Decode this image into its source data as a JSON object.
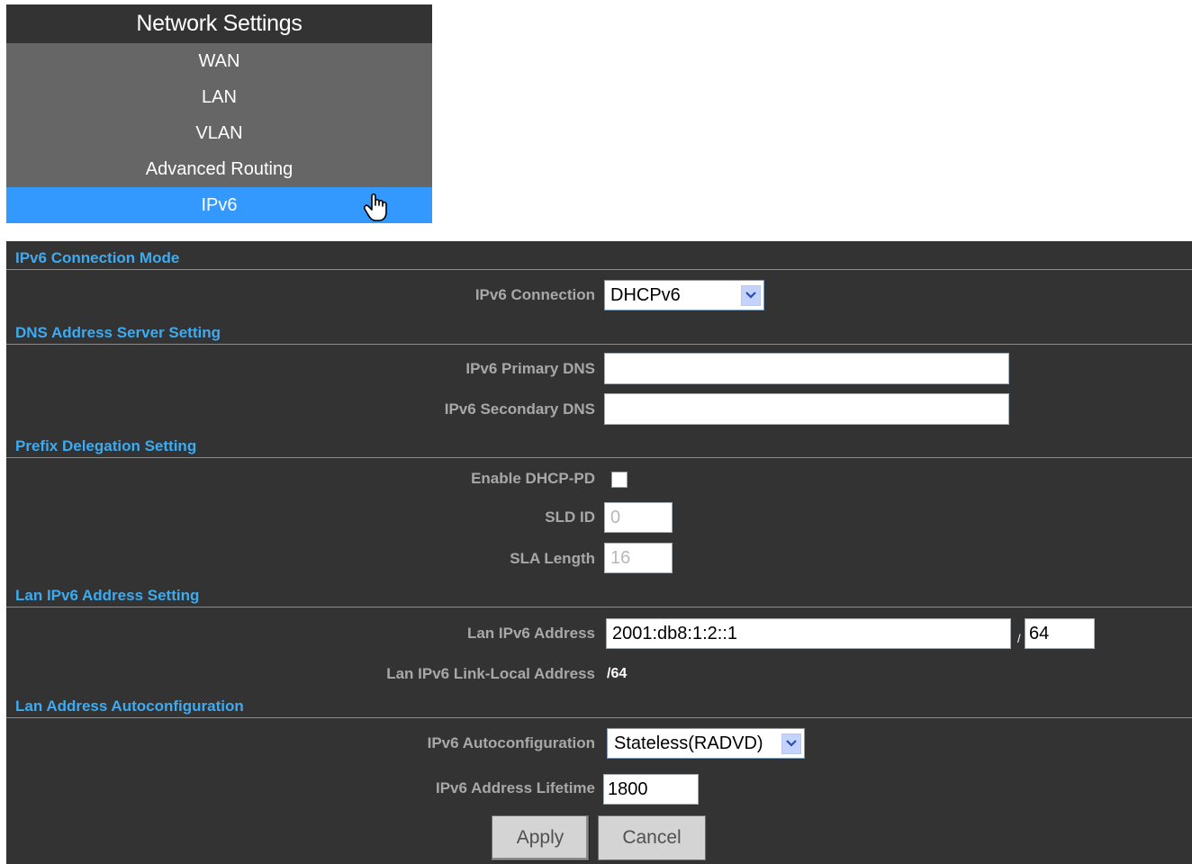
{
  "menu": {
    "title": "Network Settings",
    "items": [
      {
        "label": "WAN"
      },
      {
        "label": "LAN"
      },
      {
        "label": "VLAN"
      },
      {
        "label": "Advanced Routing"
      },
      {
        "label": "IPv6",
        "active": true
      }
    ]
  },
  "sections": {
    "connection_mode": "IPv6 Connection Mode",
    "dns": "DNS Address Server Setting",
    "prefix": "Prefix Delegation Setting",
    "lan_address": "Lan IPv6 Address Setting",
    "autoconfig": "Lan Address Autoconfiguration"
  },
  "fields": {
    "ipv6_connection": {
      "label": "IPv6 Connection",
      "value": "DHCPv6"
    },
    "primary_dns": {
      "label": "IPv6 Primary DNS",
      "value": ""
    },
    "secondary_dns": {
      "label": "IPv6 Secondary DNS",
      "value": ""
    },
    "enable_dhcp_pd": {
      "label": "Enable DHCP-PD",
      "checked": false
    },
    "sld_id": {
      "label": "SLD ID",
      "value": "0"
    },
    "sla_length": {
      "label": "SLA Length",
      "value": "16"
    },
    "lan_ipv6_address": {
      "label": "Lan IPv6 Address",
      "value": "2001:db8:1:2::1",
      "prefix_separator": "/",
      "prefix": "64"
    },
    "link_local": {
      "label": "Lan IPv6 Link-Local Address",
      "value": "/64"
    },
    "autoconfiguration": {
      "label": "IPv6 Autoconfiguration",
      "value": "Stateless(RADVD)"
    },
    "lifetime": {
      "label": "IPv6 Address Lifetime",
      "value": "1800"
    }
  },
  "buttons": {
    "apply": "Apply",
    "cancel": "Cancel"
  },
  "colors": {
    "panel_bg": "#333333",
    "section_title": "#3eaaf0",
    "active_menu": "#3399ff",
    "menu_item_bg": "#666666"
  },
  "icons": {
    "cursor": "hand-pointer-icon",
    "dropdown": "chevron-down-icon"
  }
}
